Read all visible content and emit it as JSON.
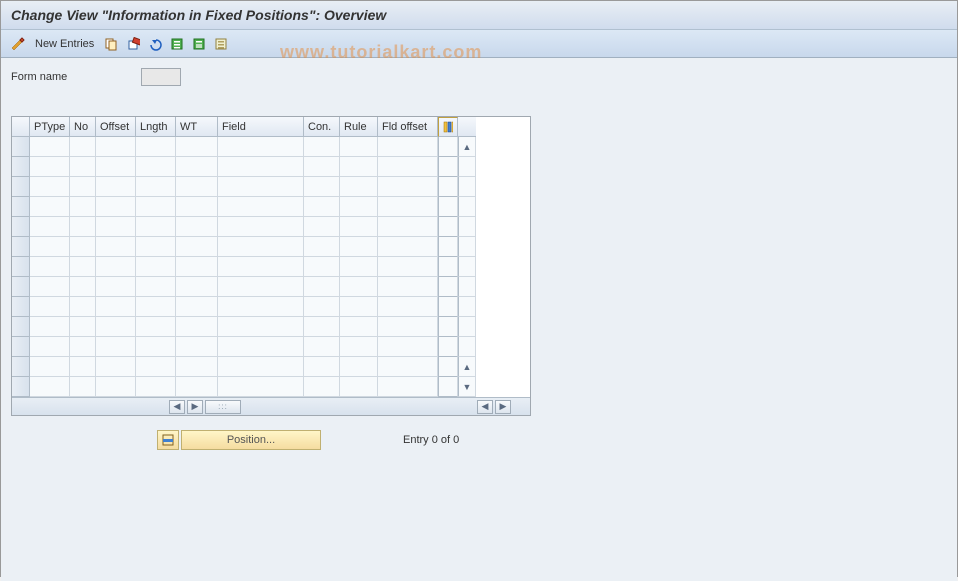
{
  "title": "Change View \"Information in Fixed Positions\": Overview",
  "toolbar": {
    "new_entries": "New Entries"
  },
  "watermark": "www.tutorialkart.com",
  "form": {
    "form_name_label": "Form name",
    "form_name_value": ""
  },
  "grid": {
    "columns": [
      "PType",
      "No",
      "Offset",
      "Lngth",
      "WT",
      "Field",
      "Con.",
      "Rule",
      "Fld offset"
    ],
    "rows": []
  },
  "footer": {
    "position_label": "Position...",
    "entry_status": "Entry 0 of 0"
  }
}
